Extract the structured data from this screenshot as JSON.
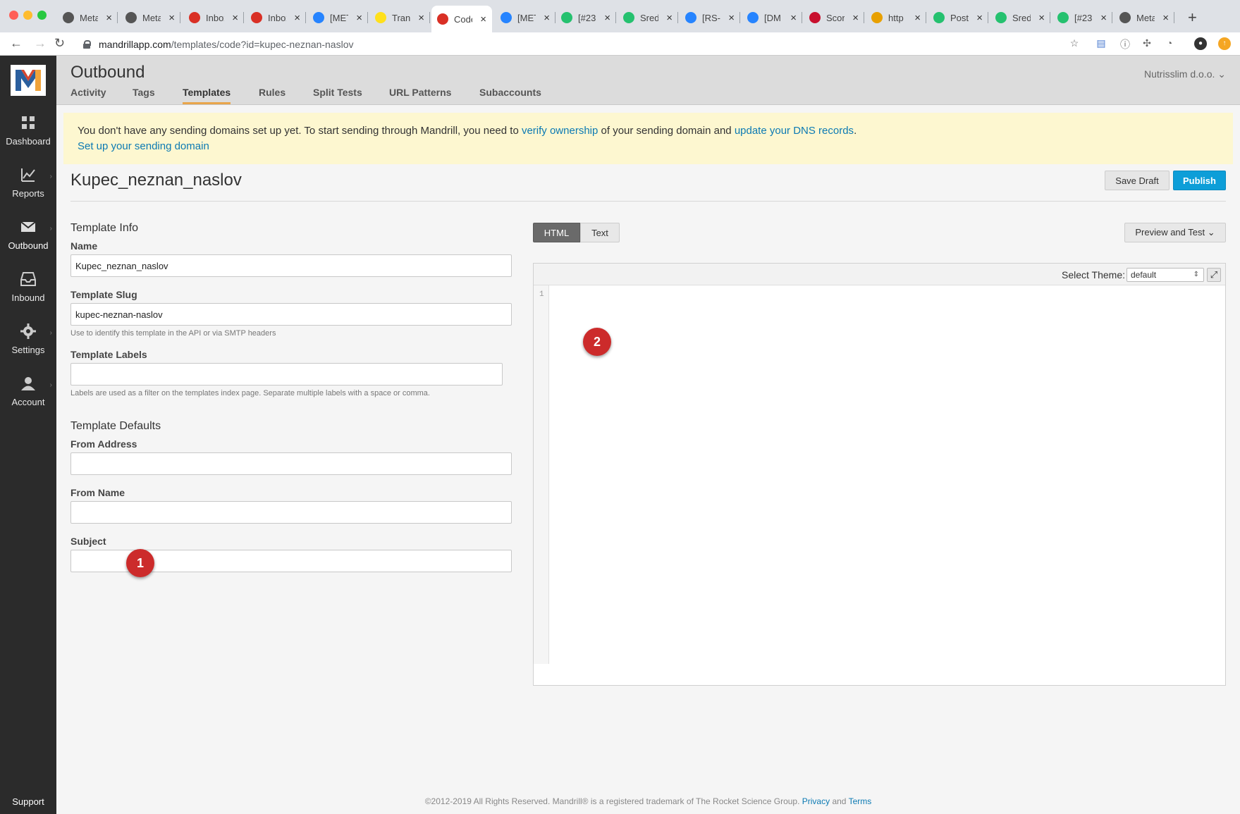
{
  "browser": {
    "tabs": [
      {
        "title": "Meta",
        "favicon": "globe-icon",
        "color": "#555555"
      },
      {
        "title": "Meta",
        "favicon": "globe-icon",
        "color": "#555555"
      },
      {
        "title": "Inbox",
        "favicon": "gmail-icon",
        "color": "#d93025"
      },
      {
        "title": "Inbox",
        "favicon": "gmail-icon",
        "color": "#d93025"
      },
      {
        "title": "[MET",
        "favicon": "jira-icon",
        "color": "#2684ff"
      },
      {
        "title": "Trans",
        "favicon": "mailchimp-icon",
        "color": "#ffe01b"
      },
      {
        "title": "Code",
        "favicon": "gmail-icon",
        "color": "#d93025",
        "active": true
      },
      {
        "title": "[MET",
        "favicon": "jira-icon",
        "color": "#2684ff"
      },
      {
        "title": "[#23",
        "favicon": "freshdesk-icon",
        "color": "#25c16f"
      },
      {
        "title": "Sred",
        "favicon": "freshdesk-icon",
        "color": "#25c16f"
      },
      {
        "title": "[RS-",
        "favicon": "jira-icon",
        "color": "#2684ff"
      },
      {
        "title": "[DM",
        "favicon": "jira-icon",
        "color": "#2684ff"
      },
      {
        "title": "Scor",
        "favicon": "nba-icon",
        "color": "#c8102e"
      },
      {
        "title": "http",
        "favicon": "stripes-icon",
        "color": "#e8a000"
      },
      {
        "title": "Post",
        "favicon": "freshdesk-icon",
        "color": "#25c16f"
      },
      {
        "title": "Sred",
        "favicon": "freshdesk-icon",
        "color": "#25c16f"
      },
      {
        "title": "[#23",
        "favicon": "freshdesk-icon",
        "color": "#25c16f"
      },
      {
        "title": "Meta",
        "favicon": "globe-icon",
        "color": "#555555"
      }
    ],
    "url_host": "mandrillapp.com",
    "url_path": "/templates/code?id=kupec-neznan-naslov"
  },
  "sidebar": {
    "items": [
      {
        "label": "Dashboard",
        "icon": "grid-icon",
        "has_submenu": false
      },
      {
        "label": "Reports",
        "icon": "chart-icon",
        "has_submenu": true
      },
      {
        "label": "Outbound",
        "icon": "envelope-icon",
        "has_submenu": true,
        "active": true
      },
      {
        "label": "Inbound",
        "icon": "inbox-icon",
        "has_submenu": false
      },
      {
        "label": "Settings",
        "icon": "gear-icon",
        "has_submenu": true
      },
      {
        "label": "Account",
        "icon": "user-icon",
        "has_submenu": true
      }
    ],
    "support_label": "Support"
  },
  "header": {
    "section_title": "Outbound",
    "tabs": [
      "Activity",
      "Tags",
      "Templates",
      "Rules",
      "Split Tests",
      "URL Patterns",
      "Subaccounts"
    ],
    "active_tab": "Templates",
    "account_name": "Nutrisslim d.o.o."
  },
  "alert": {
    "text_1": "You don't have any sending domains set up yet. To start sending through Mandrill, you need to ",
    "link_1": "verify ownership",
    "text_2": " of your sending domain and ",
    "link_2": "update your DNS records",
    "text_3": ".",
    "link_3": "Set up your sending domain"
  },
  "template": {
    "title": "Kupec_neznan_naslov",
    "save_draft_label": "Save Draft",
    "publish_label": "Publish"
  },
  "form": {
    "info_heading": "Template Info",
    "name_label": "Name",
    "name_value": "Kupec_neznan_naslov",
    "slug_label": "Template Slug",
    "slug_value": "kupec-neznan-naslov",
    "slug_help": "Use to identify this template in the API or via SMTP headers",
    "labels_label": "Template Labels",
    "labels_value": "",
    "labels_help": "Labels are used as a filter on the templates index page. Separate multiple labels with a space or comma.",
    "defaults_heading": "Template Defaults",
    "from_address_label": "From Address",
    "from_address_value": "",
    "from_name_label": "From Name",
    "from_name_value": "",
    "subject_label": "Subject",
    "subject_value": ""
  },
  "editor": {
    "mode_html": "HTML",
    "mode_text": "Text",
    "active_mode": "HTML",
    "preview_label": "Preview and Test",
    "theme_label": "Select Theme:",
    "theme_value": "default",
    "line_number": "1"
  },
  "markers": [
    {
      "label": "1",
      "color": "#cc2b2b"
    },
    {
      "label": "2",
      "color": "#cc2b2b"
    }
  ],
  "footer": {
    "text": "©2012-2019 All Rights Reserved. Mandrill® is a registered trademark of The Rocket Science Group.",
    "privacy_label": "Privacy",
    "and_label": "and",
    "terms_label": "Terms"
  }
}
